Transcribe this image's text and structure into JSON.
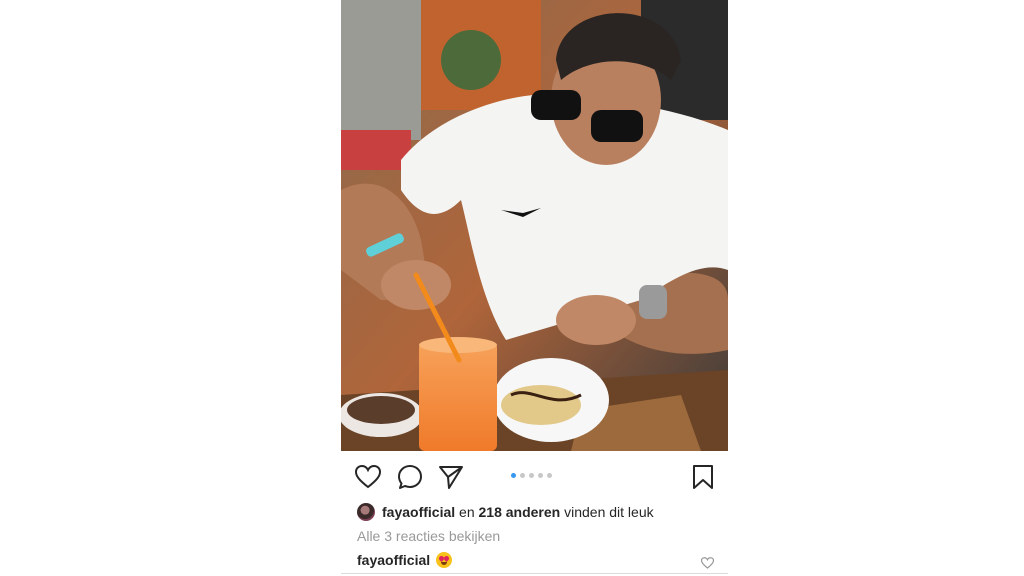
{
  "post": {
    "photo": {
      "description_icon": "post-photo",
      "carousel": {
        "count": 5,
        "active_index": 0
      }
    },
    "actions": {
      "like_icon": "heart-outline-icon",
      "comment_icon": "comment-bubble-icon",
      "share_icon": "paper-plane-icon",
      "save_icon": "bookmark-icon"
    },
    "likes": {
      "user": "fayaofficial",
      "middle": " en ",
      "count_text": "218 anderen",
      "suffix": " vinden dit leuk"
    },
    "comments_link": "Alle 3 reacties bekijken",
    "caption": {
      "user": "fayaofficial",
      "emoji": "heart-eyes-emoji"
    },
    "colors": {
      "accent_dot": "#3897f0",
      "text": "#262626",
      "muted": "#999999"
    }
  }
}
